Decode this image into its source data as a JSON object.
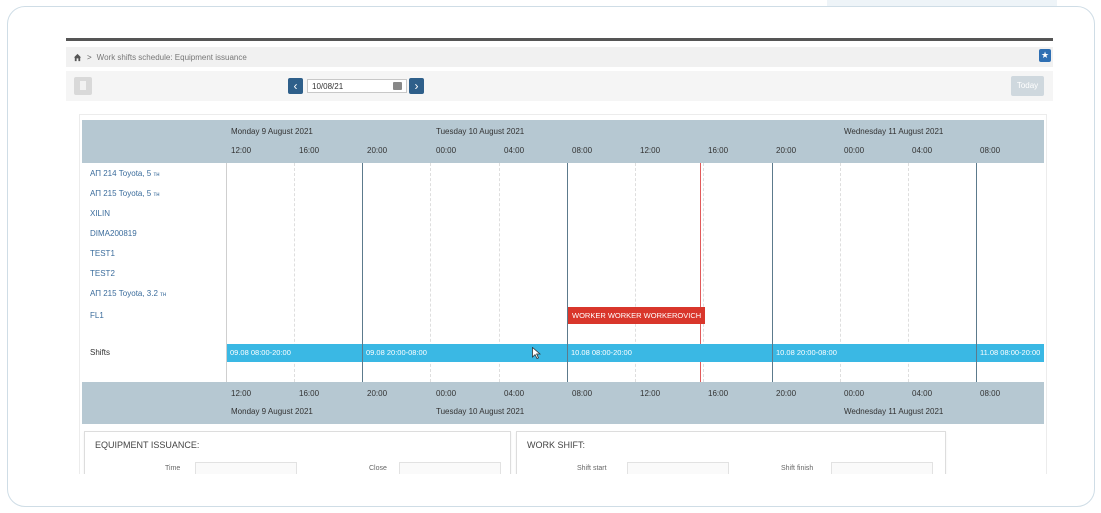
{
  "breadcrumb": {
    "title": "Work shifts schedule: Equipment issuance"
  },
  "toolbar": {
    "date_value": "10/08/21",
    "today_label": "Today"
  },
  "timeline": {
    "days_top": [
      {
        "label": "Monday 9 August 2021"
      },
      {
        "label": "Tuesday 10 August 2021"
      },
      {
        "label": "Wednesday 11 August 2021"
      }
    ],
    "ticks": [
      "12:00",
      "16:00",
      "20:00",
      "00:00",
      "04:00",
      "08:00",
      "12:00",
      "16:00",
      "20:00",
      "00:00",
      "04:00",
      "08:00"
    ]
  },
  "rows": [
    {
      "label": "АП 214 Toyota, 5",
      "unit": "тн"
    },
    {
      "label": "АП 215 Toyota, 5",
      "unit": "тн"
    },
    {
      "label": "XILIN",
      "unit": ""
    },
    {
      "label": "DIMA200819",
      "unit": ""
    },
    {
      "label": "TEST1",
      "unit": ""
    },
    {
      "label": "TEST2",
      "unit": ""
    },
    {
      "label": "АП 215 Toyota, 3.2",
      "unit": "тн"
    },
    {
      "label": "FL1",
      "unit": ""
    }
  ],
  "assignment": {
    "label": "WORKER WORKER WORKEROVICH",
    "color": "#d9362b"
  },
  "shifts": {
    "label": "Shifts",
    "items": [
      {
        "label": "09.08 08:00-20:00"
      },
      {
        "label": "09.08 20:00-08:00"
      },
      {
        "label": "10.08 08:00-20:00"
      },
      {
        "label": "10.08 20:00-08:00"
      },
      {
        "label": "11.08 08:00-20:00"
      }
    ],
    "color": "#3ab8e4"
  },
  "cards": {
    "equipment": {
      "title": "EQUIPMENT ISSUANCE:",
      "field1": "Time",
      "field2": "Close"
    },
    "shift": {
      "title": "WORK SHIFT:",
      "field1": "Shift start",
      "field2": "Shift finish"
    }
  }
}
